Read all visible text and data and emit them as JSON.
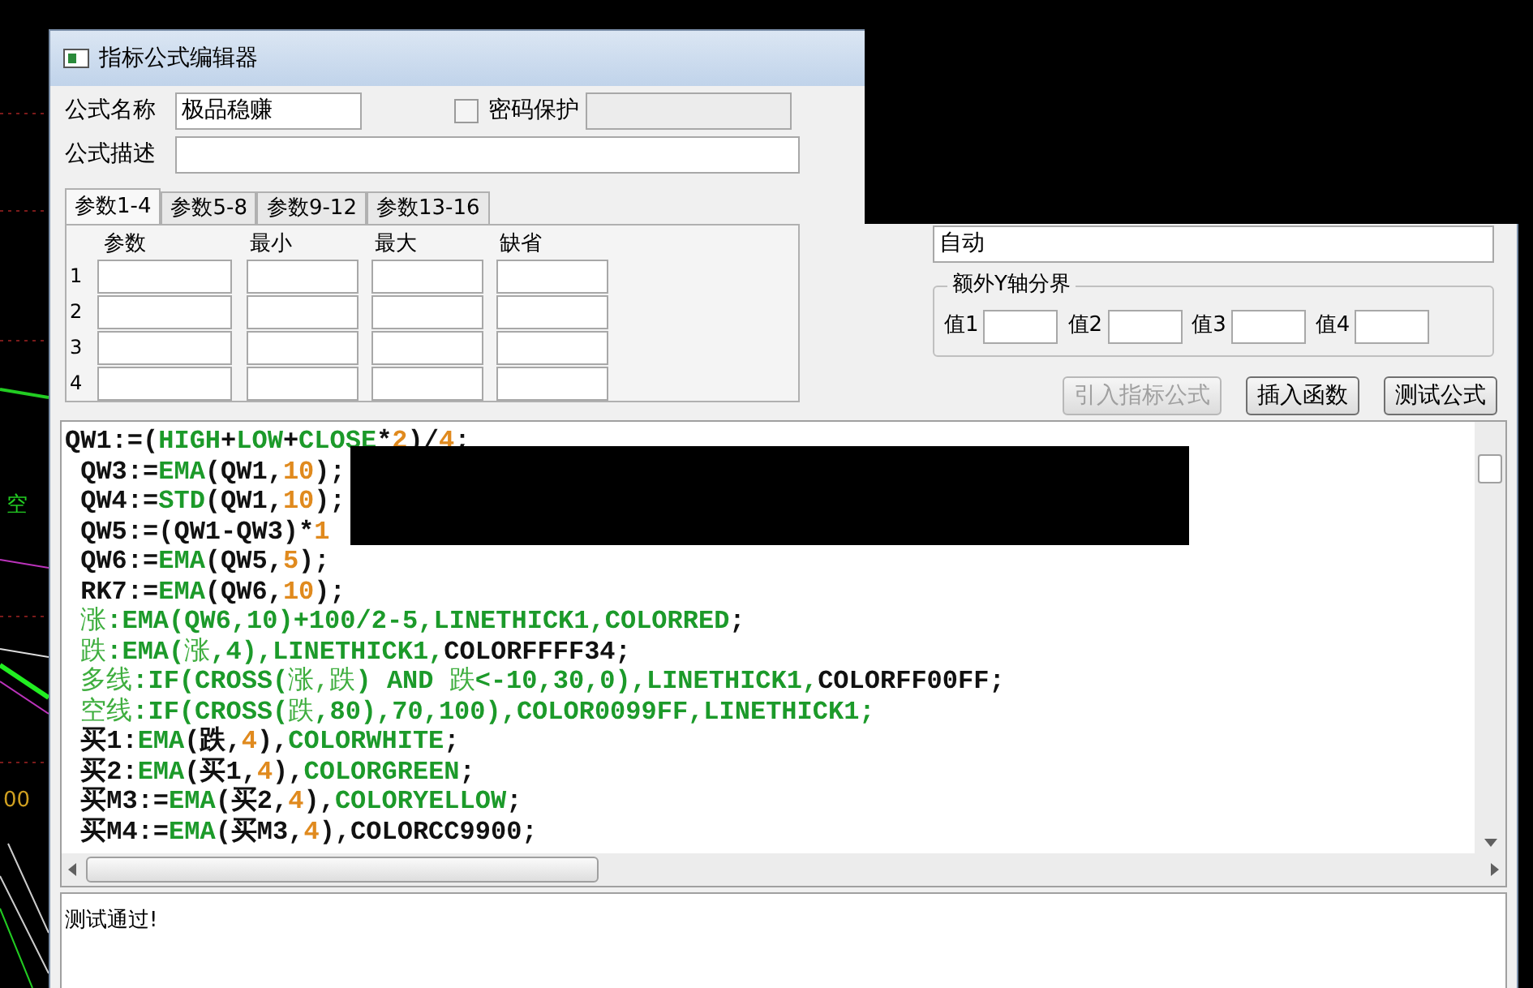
{
  "background": {
    "labels": [
      "空",
      "00"
    ]
  },
  "window": {
    "title": "指标公式编辑器"
  },
  "formula_name": {
    "label": "公式名称",
    "value": "极品稳赚"
  },
  "password": {
    "label": "密码保护",
    "checked": false,
    "field_disabled": true
  },
  "formula_description": {
    "label": "公式描述"
  },
  "tabs": [
    {
      "label": "参数1-4",
      "selected": true
    },
    {
      "label": "参数5-8",
      "selected": false
    },
    {
      "label": "参数9-12",
      "selected": false
    },
    {
      "label": "参数13-16",
      "selected": false
    }
  ],
  "params": {
    "columns": [
      "参数",
      "最小",
      "最大",
      "缺省"
    ],
    "rows": [
      "1",
      "2",
      "3",
      "4"
    ]
  },
  "axis_field": {
    "value": "自动"
  },
  "y_axis_group": {
    "title": "额外Y轴分界",
    "fields": [
      "值1",
      "值2",
      "值3",
      "值4"
    ]
  },
  "buttons": [
    {
      "label": "引入指标公式",
      "disabled": true
    },
    {
      "label": "插入函数",
      "disabled": false
    },
    {
      "label": "测试公式",
      "disabled": false
    }
  ],
  "code_lines": [
    [
      {
        "text": "QW1:=(",
        "kind": "plain"
      },
      {
        "text": "HIGH",
        "kind": "keyword"
      },
      {
        "text": "+",
        "kind": "plain"
      },
      {
        "text": "LOW",
        "kind": "keyword"
      },
      {
        "text": "+",
        "kind": "plain"
      },
      {
        "text": "CLOSE",
        "kind": "keyword"
      },
      {
        "text": "*",
        "kind": "plain"
      },
      {
        "text": "2",
        "kind": "number"
      },
      {
        "text": ")/",
        "kind": "plain"
      },
      {
        "text": "4",
        "kind": "number"
      },
      {
        "text": ";",
        "kind": "plain"
      }
    ],
    [
      {
        "text": " QW3:=",
        "kind": "plain"
      },
      {
        "text": "EMA",
        "kind": "keyword"
      },
      {
        "text": "(QW1,",
        "kind": "plain"
      },
      {
        "text": "10",
        "kind": "number"
      },
      {
        "text": ");",
        "kind": "plain"
      }
    ],
    [
      {
        "text": " QW4:=",
        "kind": "plain"
      },
      {
        "text": "STD",
        "kind": "keyword"
      },
      {
        "text": "(QW1,",
        "kind": "plain"
      },
      {
        "text": "10",
        "kind": "number"
      },
      {
        "text": ");",
        "kind": "plain"
      }
    ],
    [
      {
        "text": " QW5:=(QW1-QW3)*",
        "kind": "plain"
      },
      {
        "text": "1",
        "kind": "number"
      }
    ],
    [
      {
        "text": " QW6:=",
        "kind": "plain"
      },
      {
        "text": "EMA",
        "kind": "keyword"
      },
      {
        "text": "(QW5,",
        "kind": "plain"
      },
      {
        "text": "5",
        "kind": "number"
      },
      {
        "text": ");",
        "kind": "plain"
      }
    ],
    [
      {
        "text": " RK7:=",
        "kind": "plain"
      },
      {
        "text": "EMA",
        "kind": "keyword"
      },
      {
        "text": "(QW6,",
        "kind": "plain"
      },
      {
        "text": "10",
        "kind": "number"
      },
      {
        "text": ");",
        "kind": "plain"
      }
    ],
    [
      {
        "text": " 涨",
        "kind": "name"
      },
      {
        "text": ":EMA(QW6,10)+100/2-5,LINETHICK1,COLORRED",
        "kind": "keyword"
      },
      {
        "text": ";",
        "kind": "plain"
      }
    ],
    [
      {
        "text": " 跌",
        "kind": "name"
      },
      {
        "text": ":EMA(",
        "kind": "keyword"
      },
      {
        "text": "涨",
        "kind": "name"
      },
      {
        "text": ",4),LINETHICK1,",
        "kind": "keyword"
      },
      {
        "text": "COLORFFFF34;",
        "kind": "plain"
      }
    ],
    [
      {
        "text": " 多线",
        "kind": "name"
      },
      {
        "text": ":IF(CROSS(",
        "kind": "keyword"
      },
      {
        "text": "涨,跌",
        "kind": "name"
      },
      {
        "text": ") AND ",
        "kind": "keyword"
      },
      {
        "text": "跌",
        "kind": "name"
      },
      {
        "text": "<-10,30,0),LINETHICK1,",
        "kind": "keyword"
      },
      {
        "text": "COLORFF00FF;",
        "kind": "plain"
      }
    ],
    [
      {
        "text": " 空线",
        "kind": "name"
      },
      {
        "text": ":IF(CROSS(",
        "kind": "keyword"
      },
      {
        "text": "跌",
        "kind": "name"
      },
      {
        "text": ",80),70,100),COLOR0099FF,LINETHICK1;",
        "kind": "keyword"
      }
    ],
    [
      {
        "text": " 买1:",
        "kind": "plain"
      },
      {
        "text": "EMA",
        "kind": "keyword"
      },
      {
        "text": "(跌,",
        "kind": "plain"
      },
      {
        "text": "4",
        "kind": "number"
      },
      {
        "text": "),",
        "kind": "plain"
      },
      {
        "text": "COLORWHITE",
        "kind": "keyword"
      },
      {
        "text": ";",
        "kind": "plain"
      }
    ],
    [
      {
        "text": " 买2:",
        "kind": "plain"
      },
      {
        "text": "EMA",
        "kind": "keyword"
      },
      {
        "text": "(买1,",
        "kind": "plain"
      },
      {
        "text": "4",
        "kind": "number"
      },
      {
        "text": "),",
        "kind": "plain"
      },
      {
        "text": "COLORGREEN",
        "kind": "keyword"
      },
      {
        "text": ";",
        "kind": "plain"
      }
    ],
    [
      {
        "text": " 买M3:=",
        "kind": "plain"
      },
      {
        "text": "EMA",
        "kind": "keyword"
      },
      {
        "text": "(买2,",
        "kind": "plain"
      },
      {
        "text": "4",
        "kind": "number"
      },
      {
        "text": "),",
        "kind": "plain"
      },
      {
        "text": "COLORYELLOW",
        "kind": "keyword"
      },
      {
        "text": ";",
        "kind": "plain"
      }
    ],
    [
      {
        "text": " 买M4:=",
        "kind": "plain"
      },
      {
        "text": "EMA",
        "kind": "keyword"
      },
      {
        "text": "(买M3,",
        "kind": "plain"
      },
      {
        "text": "4",
        "kind": "number"
      },
      {
        "text": "),",
        "kind": "plain"
      },
      {
        "text": "COLORCC9900;",
        "kind": "plain"
      }
    ]
  ],
  "output": {
    "text": "测试通过!"
  }
}
